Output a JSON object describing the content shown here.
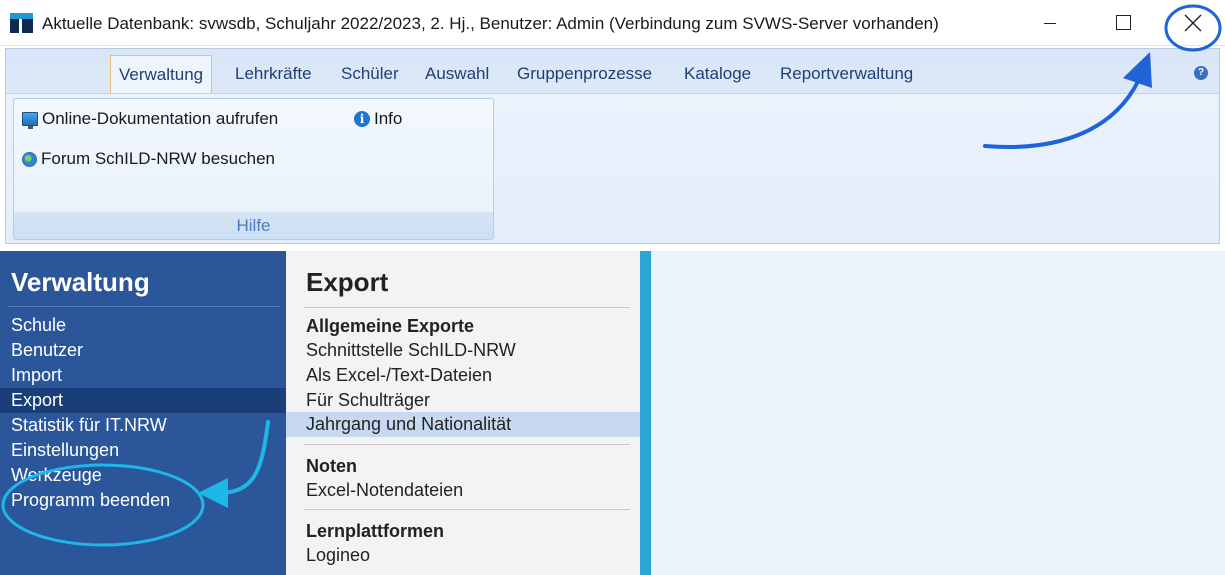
{
  "window": {
    "title": "Aktuelle Datenbank: svwsdb, Schuljahr 2022/2023, 2. Hj., Benutzer: Admin (Verbindung zum SVWS-Server vorhanden)",
    "icons": {
      "app": "schild-app-icon",
      "minimize": "minimize-icon",
      "maximize": "maximize-icon",
      "close": "close-icon"
    }
  },
  "ribbon": {
    "tabs": [
      {
        "label": "Verwaltung",
        "active": true
      },
      {
        "label": "Lehrkräfte"
      },
      {
        "label": "Schüler"
      },
      {
        "label": "Auswahl"
      },
      {
        "label": "Gruppenprozesse"
      },
      {
        "label": "Kataloge"
      },
      {
        "label": "Reportverwaltung"
      }
    ],
    "help_glyph": "?",
    "group": {
      "label": "Hilfe",
      "items": [
        {
          "label": "Online-Dokumentation aufrufen",
          "icon": "monitor-icon"
        },
        {
          "label": "Info",
          "icon": "info-icon",
          "glyph": "i"
        },
        {
          "label": "Forum SchILD-NRW besuchen",
          "icon": "globe-icon"
        }
      ]
    }
  },
  "nav": {
    "heading": "Verwaltung",
    "items": [
      {
        "label": "Schule"
      },
      {
        "label": "Benutzer"
      },
      {
        "label": "Import"
      },
      {
        "label": "Export",
        "selected": true
      },
      {
        "label": "Statistik für IT.NRW"
      },
      {
        "label": "Einstellungen"
      },
      {
        "label": "Werkzeuge"
      },
      {
        "label": "Programm beenden"
      }
    ]
  },
  "export_panel": {
    "heading": "Export",
    "sections": [
      {
        "title": "Allgemeine Exporte",
        "items": [
          "Schnittstelle SchILD-NRW",
          "Als Excel-/Text-Dateien",
          "Für Schulträger",
          "Jahrgang und Nationalität"
        ]
      },
      {
        "title": "Noten",
        "items": [
          "Excel-Notendateien"
        ]
      },
      {
        "title": "Lernplattformen",
        "items": [
          "Logineo"
        ]
      }
    ]
  },
  "annotation_colors": {
    "close_arrow": "#1f63d6",
    "exit_arrow": "#1fb6e8"
  }
}
